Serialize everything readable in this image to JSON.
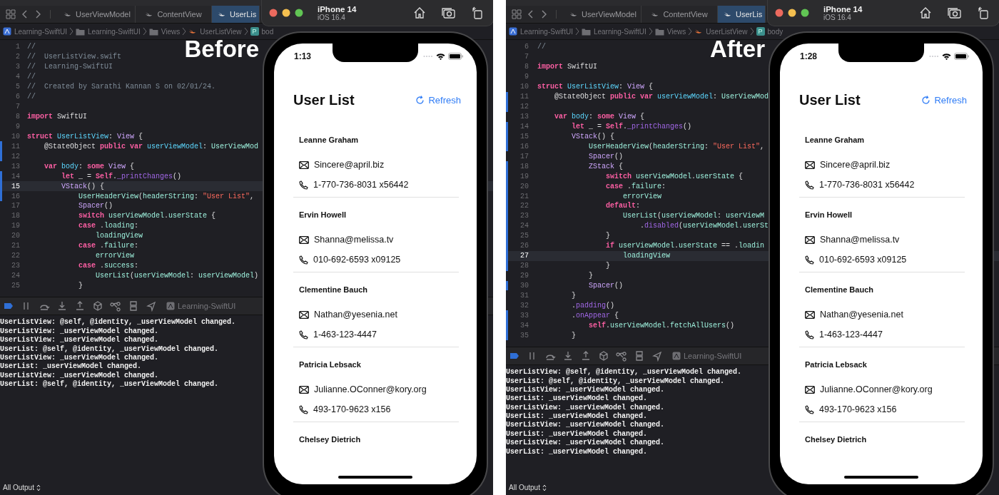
{
  "panels": [
    {
      "label": "Before",
      "tabs": [
        {
          "label": "UserViewModel",
          "selected": false
        },
        {
          "label": "ContentView",
          "selected": false
        },
        {
          "label": "UserLis",
          "selected": true
        }
      ],
      "breadcrumb": [
        {
          "kind": "project",
          "label": "Learning-SwiftUI"
        },
        {
          "kind": "folder",
          "label": "Learning-SwiftUI"
        },
        {
          "kind": "folder",
          "label": "Views"
        },
        {
          "kind": "swift",
          "label": "UserListView"
        },
        {
          "kind": "property",
          "badge": "P",
          "label": "bod"
        }
      ],
      "code": [
        {
          "number": "1",
          "changed": false,
          "selected": false,
          "tokens": [
            {
              "kind": "comment",
              "text": "//"
            }
          ]
        },
        {
          "number": "2",
          "changed": false,
          "selected": false,
          "tokens": [
            {
              "kind": "comment",
              "text": "//  UserListView.swift"
            }
          ]
        },
        {
          "number": "3",
          "changed": false,
          "selected": false,
          "tokens": [
            {
              "kind": "comment",
              "text": "//  Learning-SwiftUI"
            }
          ]
        },
        {
          "number": "4",
          "changed": false,
          "selected": false,
          "tokens": [
            {
              "kind": "comment",
              "text": "//"
            }
          ]
        },
        {
          "number": "5",
          "changed": false,
          "selected": false,
          "tokens": [
            {
              "kind": "comment",
              "text": "//  Created by Sarathi Kannan S on 02/01/24."
            }
          ]
        },
        {
          "number": "6",
          "changed": false,
          "selected": false,
          "tokens": [
            {
              "kind": "comment",
              "text": "//"
            }
          ]
        },
        {
          "number": "7",
          "changed": false,
          "selected": false
        },
        {
          "number": "8",
          "changed": false,
          "selected": false,
          "tokens": [
            {
              "kind": "keyword",
              "text": "import"
            },
            {
              "kind": "plain",
              "text": " SwiftUI"
            }
          ]
        },
        {
          "number": "9",
          "changed": false,
          "selected": false
        },
        {
          "number": "10",
          "changed": false,
          "selected": false,
          "tokens": [
            {
              "kind": "keyword",
              "text": "struct"
            },
            {
              "kind": "decl",
              "text": " UserListView"
            },
            {
              "kind": "plain",
              "text": ": "
            },
            {
              "kind": "system",
              "text": "View"
            },
            {
              "kind": "plain",
              "text": " {"
            }
          ]
        },
        {
          "number": "11",
          "changed": true,
          "selected": false,
          "tokens": [
            {
              "kind": "plain",
              "text": "    @StateObject "
            },
            {
              "kind": "keyword",
              "text": "public"
            },
            {
              "kind": "keyword",
              "text": " var"
            },
            {
              "kind": "decl",
              "text": " userViewModel"
            },
            {
              "kind": "plain",
              "text": ": "
            },
            {
              "kind": "project",
              "text": "UserViewMod"
            }
          ]
        },
        {
          "number": "12",
          "changed": true,
          "selected": false
        },
        {
          "number": "13",
          "changed": false,
          "selected": false,
          "tokens": [
            {
              "kind": "keyword",
              "text": "    var"
            },
            {
              "kind": "decl",
              "text": " body"
            },
            {
              "kind": "plain",
              "text": ": "
            },
            {
              "kind": "keyword",
              "text": "some"
            },
            {
              "kind": "system",
              "text": " View"
            },
            {
              "kind": "plain",
              "text": " {"
            }
          ]
        },
        {
          "number": "14",
          "changed": true,
          "selected": false,
          "tokens": [
            {
              "kind": "keyword",
              "text": "        let"
            },
            {
              "kind": "plain",
              "text": " _ = "
            },
            {
              "kind": "keyword",
              "text": "Self"
            },
            {
              "kind": "plain",
              "text": "."
            },
            {
              "kind": "sysfunc",
              "text": "_printChanges"
            },
            {
              "kind": "plain",
              "text": "()"
            }
          ]
        },
        {
          "number": "15",
          "changed": true,
          "selected": true,
          "tokens": [
            {
              "kind": "system",
              "text": "        VStack"
            },
            {
              "kind": "plain",
              "text": "() {"
            }
          ]
        },
        {
          "number": "16",
          "changed": true,
          "selected": false,
          "tokens": [
            {
              "kind": "project",
              "text": "            UserHeaderView"
            },
            {
              "kind": "plain",
              "text": "("
            },
            {
              "kind": "project",
              "text": "headerString"
            },
            {
              "kind": "plain",
              "text": ": "
            },
            {
              "kind": "string",
              "text": "\"User List\""
            },
            {
              "kind": "plain",
              "text": ","
            }
          ]
        },
        {
          "number": "17",
          "changed": false,
          "selected": false,
          "tokens": [
            {
              "kind": "system",
              "text": "            Spacer"
            },
            {
              "kind": "plain",
              "text": "()"
            }
          ]
        },
        {
          "number": "18",
          "changed": false,
          "selected": false,
          "tokens": [
            {
              "kind": "keyword",
              "text": "            switch"
            },
            {
              "kind": "project",
              "text": " userViewModel"
            },
            {
              "kind": "plain",
              "text": "."
            },
            {
              "kind": "project",
              "text": "userState"
            },
            {
              "kind": "plain",
              "text": " {"
            }
          ]
        },
        {
          "number": "19",
          "changed": false,
          "selected": false,
          "tokens": [
            {
              "kind": "keyword",
              "text": "            case"
            },
            {
              "kind": "plain",
              "text": " ."
            },
            {
              "kind": "project",
              "text": "loading"
            },
            {
              "kind": "plain",
              "text": ":"
            }
          ]
        },
        {
          "number": "20",
          "changed": false,
          "selected": false,
          "tokens": [
            {
              "kind": "project",
              "text": "                loadingView"
            }
          ]
        },
        {
          "number": "21",
          "changed": false,
          "selected": false,
          "tokens": [
            {
              "kind": "keyword",
              "text": "            case"
            },
            {
              "kind": "plain",
              "text": " ."
            },
            {
              "kind": "project",
              "text": "failure"
            },
            {
              "kind": "plain",
              "text": ":"
            }
          ]
        },
        {
          "number": "22",
          "changed": false,
          "selected": false,
          "tokens": [
            {
              "kind": "project",
              "text": "                errorView"
            }
          ]
        },
        {
          "number": "23",
          "changed": false,
          "selected": false,
          "tokens": [
            {
              "kind": "keyword",
              "text": "            case"
            },
            {
              "kind": "plain",
              "text": " ."
            },
            {
              "kind": "project",
              "text": "success"
            },
            {
              "kind": "plain",
              "text": ":"
            }
          ]
        },
        {
          "number": "24",
          "changed": false,
          "selected": false,
          "tokens": [
            {
              "kind": "project",
              "text": "                UserList"
            },
            {
              "kind": "plain",
              "text": "("
            },
            {
              "kind": "project",
              "text": "userViewModel"
            },
            {
              "kind": "plain",
              "text": ": "
            },
            {
              "kind": "project",
              "text": "userViewModel"
            },
            {
              "kind": "plain",
              "text": ")"
            }
          ]
        },
        {
          "number": "25",
          "changed": false,
          "selected": false,
          "tokens": [
            {
              "kind": "plain",
              "text": "            }"
            }
          ]
        }
      ],
      "debug_target": "Learning-SwiftUI",
      "console": [
        "UserListView: @self, @identity, _userViewModel changed.",
        "UserListView: _userViewModel changed.",
        "UserListView: _userViewModel changed.",
        "UserList: @self, @identity, _userViewModel changed.",
        "UserListView: _userViewModel changed.",
        "UserList: _userViewModel changed.",
        "UserListView: _userViewModel changed.",
        "UserList: @self, @identity, _userViewModel changed."
      ],
      "output_filter": "All Output",
      "simulator": {
        "device": "iPhone 14",
        "os": "iOS 16.4",
        "time": "1:13",
        "title": "User List",
        "action": "Refresh",
        "users": [
          {
            "name": "Leanne Graham",
            "email": "Sincere@april.biz",
            "phone": "1-770-736-8031 x56442"
          },
          {
            "name": "Ervin Howell",
            "email": "Shanna@melissa.tv",
            "phone": "010-692-6593 x09125"
          },
          {
            "name": "Clementine Bauch",
            "email": "Nathan@yesenia.net",
            "phone": "1-463-123-4447"
          },
          {
            "name": "Patricia Lebsack",
            "email": "Julianne.OConner@kory.org",
            "phone": "493-170-9623 x156"
          },
          {
            "name": "Chelsey Dietrich"
          }
        ]
      }
    },
    {
      "label": "After",
      "tabs": [
        {
          "label": "UserViewModel",
          "selected": false
        },
        {
          "label": "ContentView",
          "selected": false
        },
        {
          "label": "UserLis",
          "selected": true
        }
      ],
      "breadcrumb": [
        {
          "kind": "project",
          "label": "Learning-SwiftUI"
        },
        {
          "kind": "folder",
          "label": "Learning-SwiftUI"
        },
        {
          "kind": "folder",
          "label": "Views"
        },
        {
          "kind": "swift",
          "label": "UserListView"
        },
        {
          "kind": "property",
          "badge": "P",
          "label": "body"
        }
      ],
      "code": [
        {
          "number": "6",
          "changed": false,
          "selected": false,
          "tokens": [
            {
              "kind": "comment",
              "text": "//"
            }
          ]
        },
        {
          "number": "7",
          "changed": false,
          "selected": false
        },
        {
          "number": "8",
          "changed": false,
          "selected": false,
          "tokens": [
            {
              "kind": "keyword",
              "text": "import"
            },
            {
              "kind": "plain",
              "text": " SwiftUI"
            }
          ]
        },
        {
          "number": "9",
          "changed": false,
          "selected": false
        },
        {
          "number": "10",
          "changed": false,
          "selected": false,
          "tokens": [
            {
              "kind": "keyword",
              "text": "struct"
            },
            {
              "kind": "decl",
              "text": " UserListView"
            },
            {
              "kind": "plain",
              "text": ": "
            },
            {
              "kind": "system",
              "text": "View"
            },
            {
              "kind": "plain",
              "text": " {"
            }
          ]
        },
        {
          "number": "11",
          "changed": true,
          "selected": false,
          "tokens": [
            {
              "kind": "plain",
              "text": "    @StateObject "
            },
            {
              "kind": "keyword",
              "text": "public"
            },
            {
              "kind": "keyword",
              "text": " var"
            },
            {
              "kind": "decl",
              "text": " userViewModel"
            },
            {
              "kind": "plain",
              "text": ": "
            },
            {
              "kind": "project",
              "text": "UserViewMod"
            }
          ]
        },
        {
          "number": "12",
          "changed": true,
          "selected": false
        },
        {
          "number": "13",
          "changed": false,
          "selected": false,
          "tokens": [
            {
              "kind": "keyword",
              "text": "    var"
            },
            {
              "kind": "decl",
              "text": " body"
            },
            {
              "kind": "plain",
              "text": ": "
            },
            {
              "kind": "keyword",
              "text": "some"
            },
            {
              "kind": "system",
              "text": " View"
            },
            {
              "kind": "plain",
              "text": " {"
            }
          ]
        },
        {
          "number": "14",
          "changed": true,
          "selected": false,
          "tokens": [
            {
              "kind": "keyword",
              "text": "        let"
            },
            {
              "kind": "plain",
              "text": " _ = "
            },
            {
              "kind": "keyword",
              "text": "Self"
            },
            {
              "kind": "plain",
              "text": "."
            },
            {
              "kind": "sysfunc",
              "text": "_printChanges"
            },
            {
              "kind": "plain",
              "text": "()"
            }
          ]
        },
        {
          "number": "15",
          "changed": true,
          "selected": false,
          "tokens": [
            {
              "kind": "system",
              "text": "        VStack"
            },
            {
              "kind": "plain",
              "text": "() {"
            }
          ]
        },
        {
          "number": "16",
          "changed": true,
          "selected": false,
          "tokens": [
            {
              "kind": "project",
              "text": "            UserHeaderView"
            },
            {
              "kind": "plain",
              "text": "("
            },
            {
              "kind": "project",
              "text": "headerString"
            },
            {
              "kind": "plain",
              "text": ": "
            },
            {
              "kind": "string",
              "text": "\"User List\""
            },
            {
              "kind": "plain",
              "text": ","
            }
          ]
        },
        {
          "number": "17",
          "changed": false,
          "selected": false,
          "tokens": [
            {
              "kind": "system",
              "text": "            Spacer"
            },
            {
              "kind": "plain",
              "text": "()"
            }
          ]
        },
        {
          "number": "18",
          "changed": true,
          "selected": false,
          "tokens": [
            {
              "kind": "system",
              "text": "            ZStack"
            },
            {
              "kind": "plain",
              "text": " {"
            }
          ]
        },
        {
          "number": "19",
          "changed": true,
          "selected": false,
          "tokens": [
            {
              "kind": "keyword",
              "text": "                switch"
            },
            {
              "kind": "project",
              "text": " userViewModel"
            },
            {
              "kind": "plain",
              "text": "."
            },
            {
              "kind": "project",
              "text": "userState"
            },
            {
              "kind": "plain",
              "text": " {"
            }
          ]
        },
        {
          "number": "20",
          "changed": true,
          "selected": false,
          "tokens": [
            {
              "kind": "keyword",
              "text": "                case"
            },
            {
              "kind": "plain",
              "text": " ."
            },
            {
              "kind": "project",
              "text": "failure"
            },
            {
              "kind": "plain",
              "text": ":"
            }
          ]
        },
        {
          "number": "21",
          "changed": true,
          "selected": false,
          "tokens": [
            {
              "kind": "project",
              "text": "                    errorView"
            }
          ]
        },
        {
          "number": "22",
          "changed": true,
          "selected": false,
          "tokens": [
            {
              "kind": "keyword",
              "text": "                default"
            },
            {
              "kind": "plain",
              "text": ":"
            }
          ]
        },
        {
          "number": "23",
          "changed": true,
          "selected": false,
          "tokens": [
            {
              "kind": "project",
              "text": "                    UserList"
            },
            {
              "kind": "plain",
              "text": "("
            },
            {
              "kind": "project",
              "text": "userViewModel"
            },
            {
              "kind": "plain",
              "text": ": "
            },
            {
              "kind": "project",
              "text": "userViewM"
            }
          ]
        },
        {
          "number": "24",
          "changed": true,
          "selected": false,
          "tokens": [
            {
              "kind": "plain",
              "text": "                        ."
            },
            {
              "kind": "sysfunc",
              "text": "disabled"
            },
            {
              "kind": "plain",
              "text": "("
            },
            {
              "kind": "project",
              "text": "userViewModel"
            },
            {
              "kind": "plain",
              "text": "."
            },
            {
              "kind": "project",
              "text": "userSt"
            }
          ]
        },
        {
          "number": "25",
          "changed": true,
          "selected": false,
          "tokens": [
            {
              "kind": "plain",
              "text": "                }"
            }
          ]
        },
        {
          "number": "26",
          "changed": true,
          "selected": false,
          "tokens": [
            {
              "kind": "keyword",
              "text": "                if"
            },
            {
              "kind": "project",
              "text": " userViewModel"
            },
            {
              "kind": "plain",
              "text": "."
            },
            {
              "kind": "project",
              "text": "userState"
            },
            {
              "kind": "plain",
              "text": " == ."
            },
            {
              "kind": "project",
              "text": "loadin"
            }
          ]
        },
        {
          "number": "27",
          "changed": true,
          "selected": true,
          "tokens": [
            {
              "kind": "project",
              "text": "                    loadingView"
            }
          ]
        },
        {
          "number": "28",
          "changed": true,
          "selected": false,
          "tokens": [
            {
              "kind": "plain",
              "text": "                }"
            }
          ]
        },
        {
          "number": "29",
          "changed": false,
          "selected": false,
          "tokens": [
            {
              "kind": "plain",
              "text": "            }"
            }
          ]
        },
        {
          "number": "30",
          "changed": true,
          "selected": false,
          "tokens": [
            {
              "kind": "system",
              "text": "            Spacer"
            },
            {
              "kind": "plain",
              "text": "()"
            }
          ]
        },
        {
          "number": "31",
          "changed": false,
          "selected": false,
          "tokens": [
            {
              "kind": "plain",
              "text": "        }"
            }
          ]
        },
        {
          "number": "32",
          "changed": false,
          "selected": false,
          "tokens": [
            {
              "kind": "plain",
              "text": "        ."
            },
            {
              "kind": "sysfunc",
              "text": "padding"
            },
            {
              "kind": "plain",
              "text": "()"
            }
          ]
        },
        {
          "number": "33",
          "changed": true,
          "selected": false,
          "tokens": [
            {
              "kind": "plain",
              "text": "        ."
            },
            {
              "kind": "sysfunc",
              "text": "onAppear"
            },
            {
              "kind": "plain",
              "text": " {"
            }
          ]
        },
        {
          "number": "34",
          "changed": true,
          "selected": false,
          "tokens": [
            {
              "kind": "keyword",
              "text": "            self"
            },
            {
              "kind": "plain",
              "text": "."
            },
            {
              "kind": "project",
              "text": "userViewModel"
            },
            {
              "kind": "plain",
              "text": "."
            },
            {
              "kind": "project",
              "text": "fetchAllUsers"
            },
            {
              "kind": "plain",
              "text": "()"
            }
          ]
        },
        {
          "number": "35",
          "changed": true,
          "selected": false,
          "tokens": [
            {
              "kind": "plain",
              "text": "        }"
            }
          ]
        }
      ],
      "debug_target": "Learning-SwiftUI",
      "console": [
        "UserListView: @self, @identity, _userViewModel changed.",
        "UserList: @self, @identity, _userViewModel changed.",
        "UserListView: _userViewModel changed.",
        "UserList: _userViewModel changed.",
        "UserListView: _userViewModel changed.",
        "UserList: _userViewModel changed.",
        "UserListView: _userViewModel changed.",
        "UserList: _userViewModel changed.",
        "UserListView: _userViewModel changed.",
        "UserList: _userViewModel changed."
      ],
      "output_filter": "All Output",
      "simulator": {
        "device": "iPhone 14",
        "os": "iOS 16.4",
        "time": "1:28",
        "title": "User List",
        "action": "Refresh",
        "users": [
          {
            "name": "Leanne Graham",
            "email": "Sincere@april.biz",
            "phone": "1-770-736-8031 x56442"
          },
          {
            "name": "Ervin Howell",
            "email": "Shanna@melissa.tv",
            "phone": "010-692-6593 x09125"
          },
          {
            "name": "Clementine Bauch",
            "email": "Nathan@yesenia.net",
            "phone": "1-463-123-4447"
          },
          {
            "name": "Patricia Lebsack",
            "email": "Julianne.OConner@kory.org",
            "phone": "493-170-9623 x156"
          },
          {
            "name": "Chelsey Dietrich"
          }
        ]
      }
    }
  ]
}
